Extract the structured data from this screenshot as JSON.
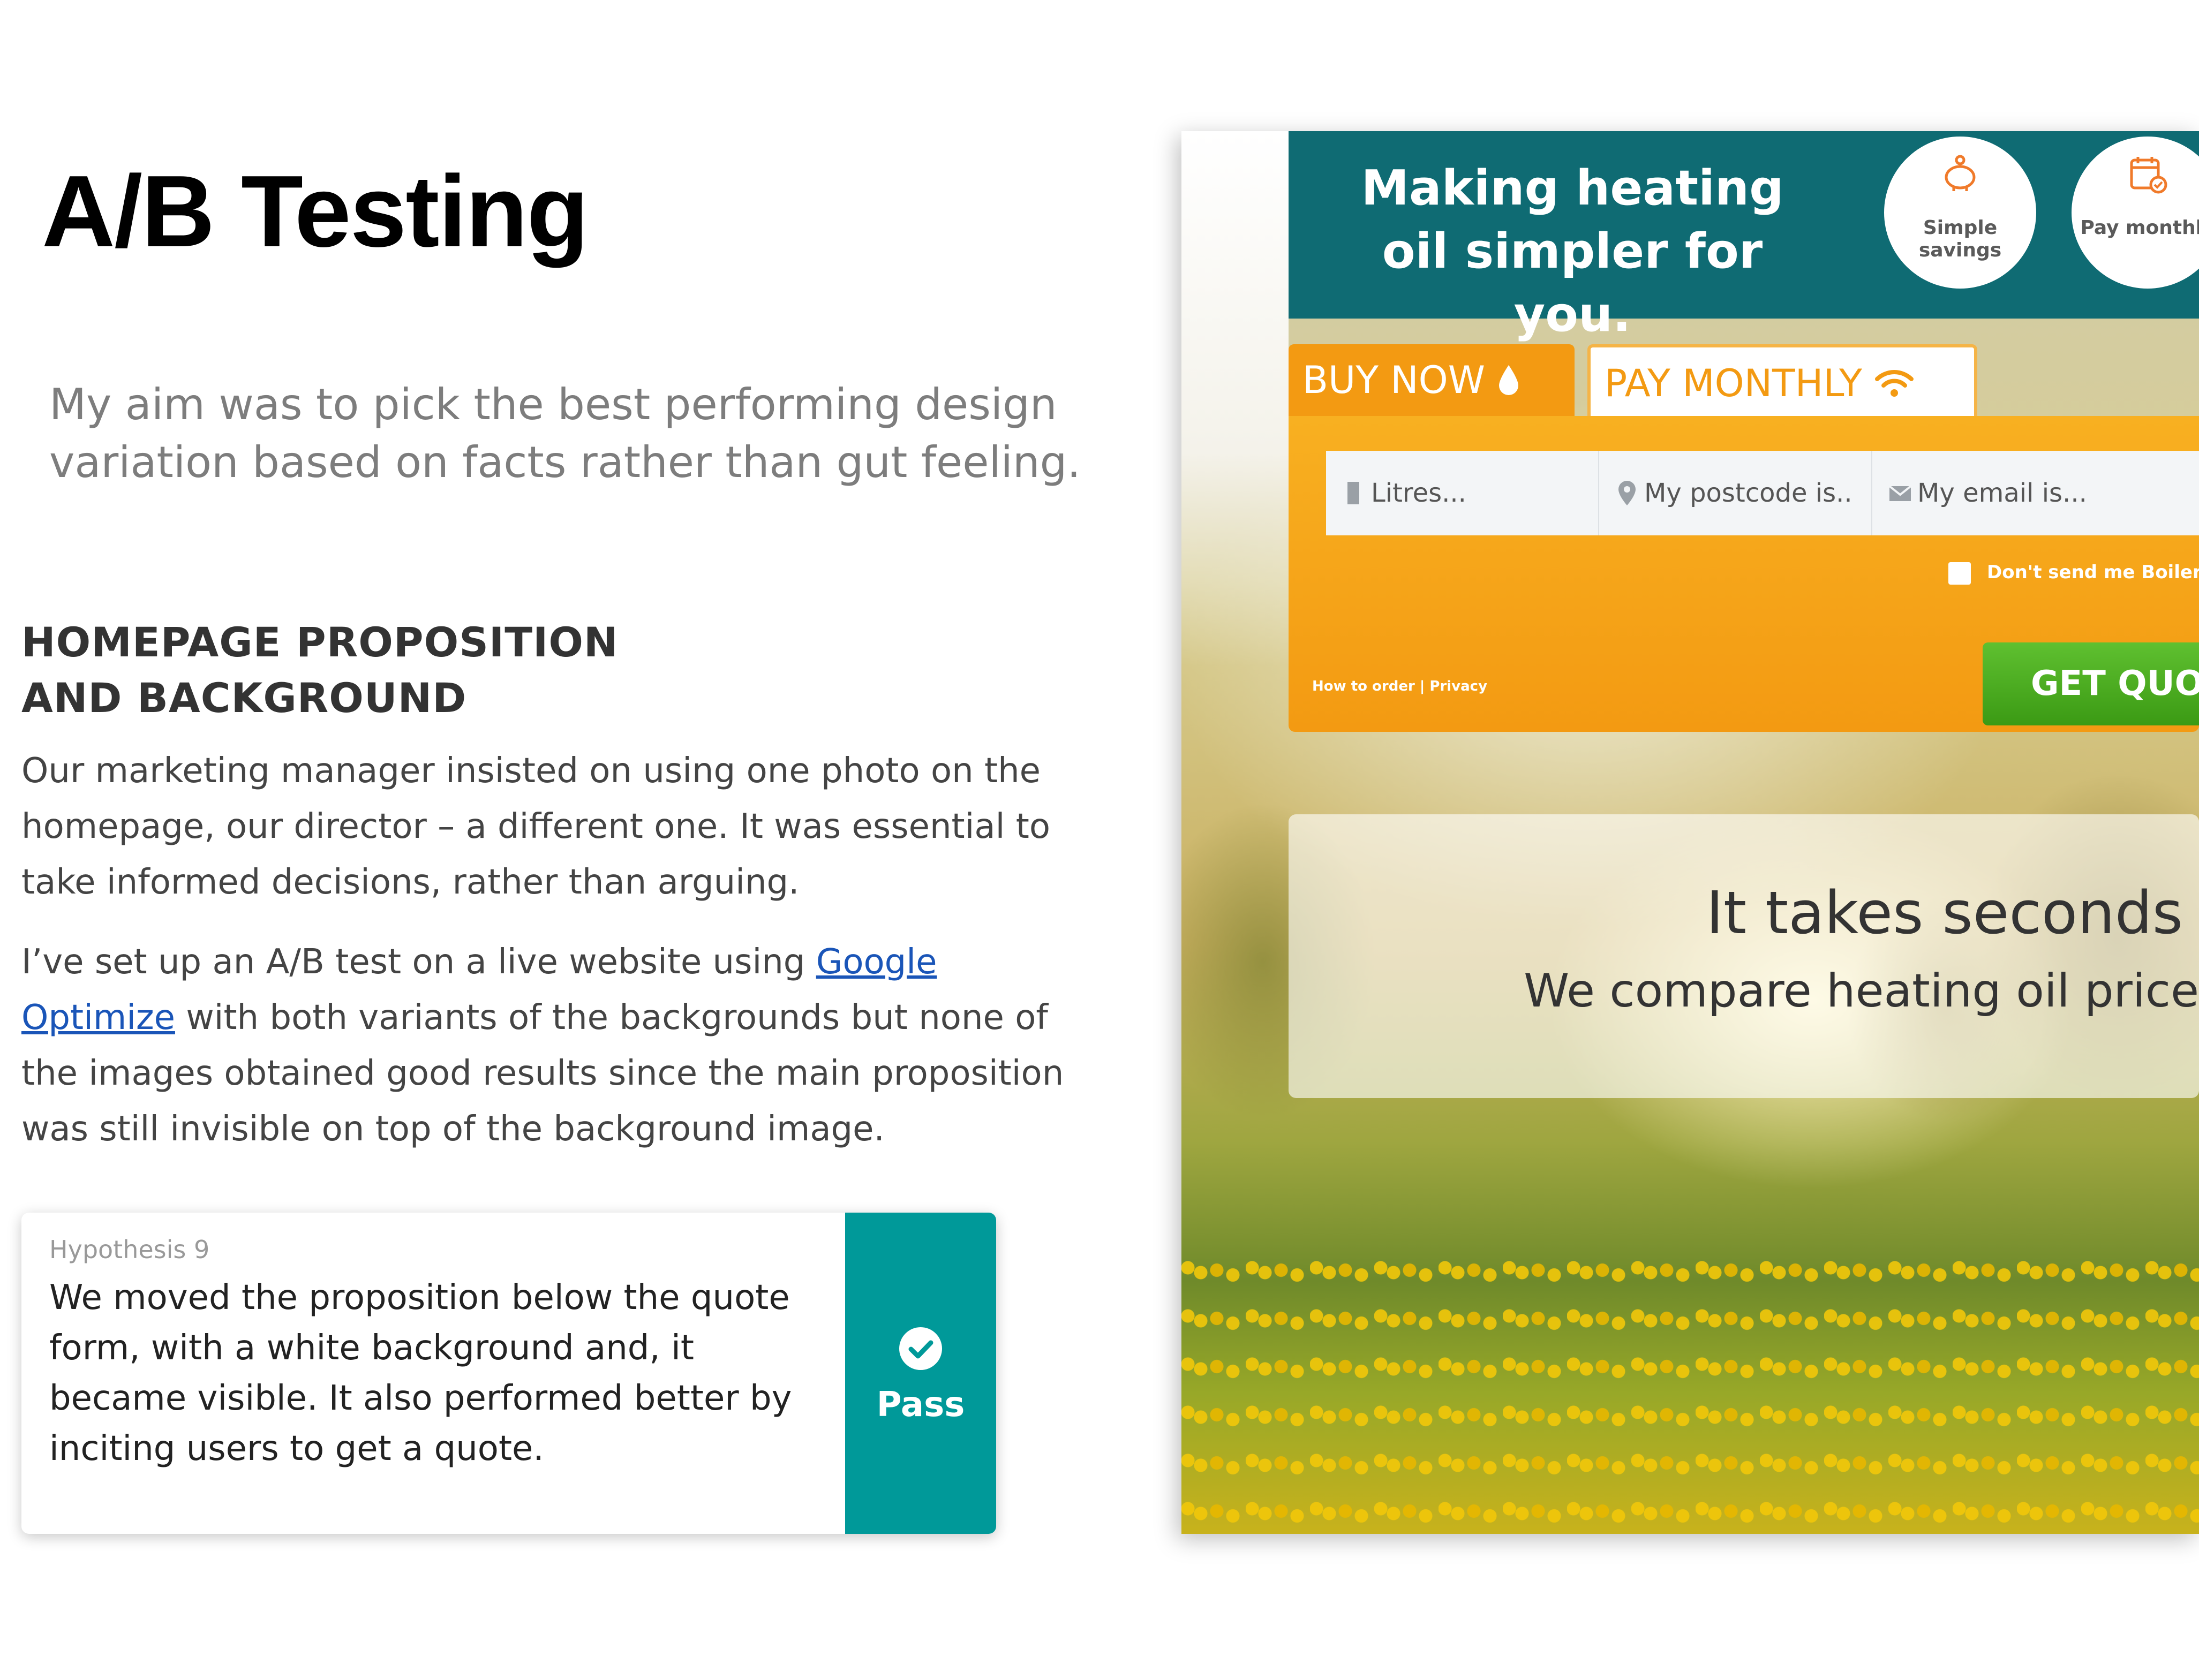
{
  "title": "A/B Testing",
  "intro": "My aim was to pick the best performing design variation based on facts rather than gut feeling.",
  "section": {
    "heading": "HOMEPAGE PROPOSITION AND BACKGROUND",
    "para1": "Our marketing manager insisted on using one photo on the homepage, our director – a different one. It was essential to take informed decisions, rather than arguing.",
    "para2_before": "I’ve set up an A/B test on a live website using ",
    "para2_link": "Google Optimize",
    "para2_after": " with both variants of the backgrounds but none of the images obtained good results since the main proposition was still invisible on top of the background image."
  },
  "hypothesis": {
    "label": "Hypothesis 9",
    "text": "We moved the proposition below the quote form, with a white background and, it became visible. It also performed better by inciting users to get a quote.",
    "status": "Pass",
    "status_icon": "check-circle-icon",
    "color": "#009999"
  },
  "screenshot": {
    "banner": {
      "text": "Making heating oil simpler for you.",
      "badge1": "Simple savings",
      "badge1_icon": "piggy-bank-icon",
      "badge2": "Pay monthly",
      "badge2_icon": "calendar-check-icon",
      "color": "#0f6b73"
    },
    "tabs": {
      "buy_now": "BUY NOW",
      "buy_now_icon": "drop-icon",
      "pay_monthly": "PAY MONTHLY",
      "pay_monthly_icon": "wifi-icon",
      "accent": "#f39a12"
    },
    "form": {
      "litres_placeholder": "Litres...",
      "postcode_placeholder": "My postcode is..",
      "email_placeholder": "My email is...",
      "checkbox_label": "Don't send me Boilerj",
      "submit": "GET QUO",
      "links": "How to order | Privacy"
    },
    "proposition": {
      "title": "It takes seconds",
      "subtitle": "We compare heating oil price"
    }
  }
}
